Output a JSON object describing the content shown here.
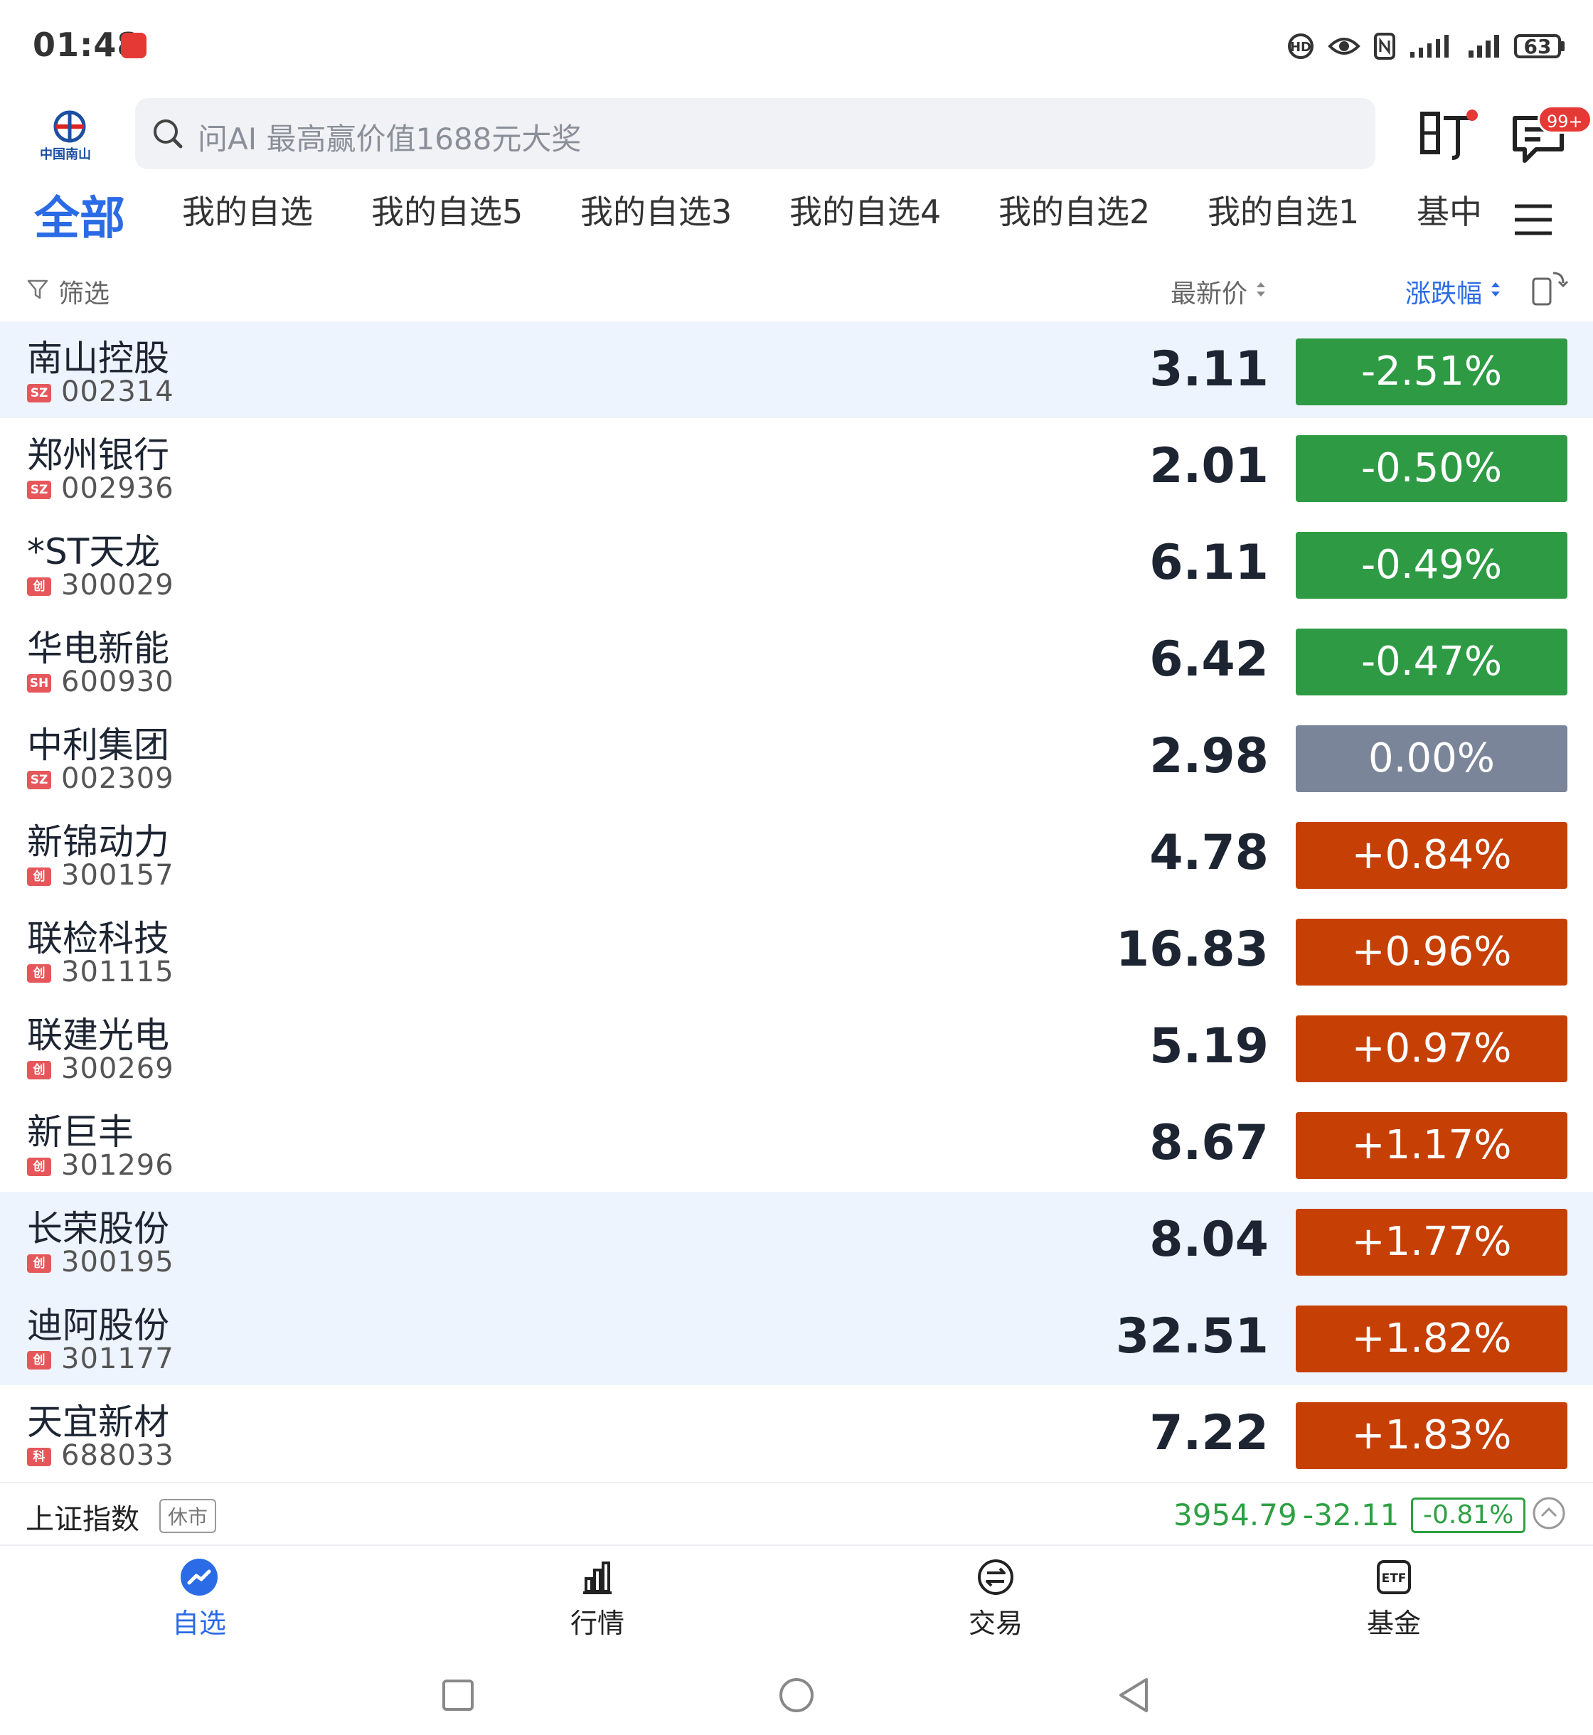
{
  "status_bar": {
    "time": "01:48",
    "battery": "63",
    "icons": [
      "hd-icon",
      "eye-icon",
      "nfc-icon",
      "signal-icon",
      "signal-icon"
    ]
  },
  "header": {
    "logo_text": "中国南山",
    "search_placeholder": "问AI 最高赢价值1688元大奖",
    "message_badge": "99+"
  },
  "tabs": {
    "active": "全部",
    "items": [
      "我的自选",
      "我的自选5",
      "我的自选3",
      "我的自选4",
      "我的自选2",
      "我的自选1",
      "基中"
    ]
  },
  "list_header": {
    "filter": "筛选",
    "price": "最新价",
    "change": "涨跌幅"
  },
  "colors": {
    "down": "#2e9b44",
    "flat": "#7b8599",
    "up": "#c63f05",
    "accent": "#2b6be6",
    "highlight_row": "#eef4fd"
  },
  "stocks": [
    {
      "name": "南山控股",
      "exchange": "SZ",
      "code": "002314",
      "price": "3.11",
      "change": "-2.51%",
      "trend": "down",
      "highlight": true
    },
    {
      "name": "郑州银行",
      "exchange": "SZ",
      "code": "002936",
      "price": "2.01",
      "change": "-0.50%",
      "trend": "down",
      "highlight": false
    },
    {
      "name": "*ST天龙",
      "exchange": "创",
      "code": "300029",
      "price": "6.11",
      "change": "-0.49%",
      "trend": "down",
      "highlight": false
    },
    {
      "name": "华电新能",
      "exchange": "SH",
      "code": "600930",
      "price": "6.42",
      "change": "-0.47%",
      "trend": "down",
      "highlight": false
    },
    {
      "name": "中利集团",
      "exchange": "SZ",
      "code": "002309",
      "price": "2.98",
      "change": "0.00%",
      "trend": "flat",
      "highlight": false
    },
    {
      "name": "新锦动力",
      "exchange": "创",
      "code": "300157",
      "price": "4.78",
      "change": "+0.84%",
      "trend": "up",
      "highlight": false
    },
    {
      "name": "联检科技",
      "exchange": "创",
      "code": "301115",
      "price": "16.83",
      "change": "+0.96%",
      "trend": "up",
      "highlight": false
    },
    {
      "name": "联建光电",
      "exchange": "创",
      "code": "300269",
      "price": "5.19",
      "change": "+0.97%",
      "trend": "up",
      "highlight": false
    },
    {
      "name": "新巨丰",
      "exchange": "创",
      "code": "301296",
      "price": "8.67",
      "change": "+1.17%",
      "trend": "up",
      "highlight": false
    },
    {
      "name": "长荣股份",
      "exchange": "创",
      "code": "300195",
      "price": "8.04",
      "change": "+1.77%",
      "trend": "up",
      "highlight": true
    },
    {
      "name": "迪阿股份",
      "exchange": "创",
      "code": "301177",
      "price": "32.51",
      "change": "+1.82%",
      "trend": "up",
      "highlight": true
    },
    {
      "name": "天宜新材",
      "exchange": "科",
      "code": "688033",
      "price": "7.22",
      "change": "+1.83%",
      "trend": "up",
      "highlight": false
    }
  ],
  "index_bar": {
    "name": "上证指数",
    "status": "休市",
    "value": "3954.79",
    "change": "-32.11",
    "pct": "-0.81%"
  },
  "bottom_nav": {
    "watchlist": "自选",
    "market": "行情",
    "trade": "交易",
    "fund": "基金"
  }
}
